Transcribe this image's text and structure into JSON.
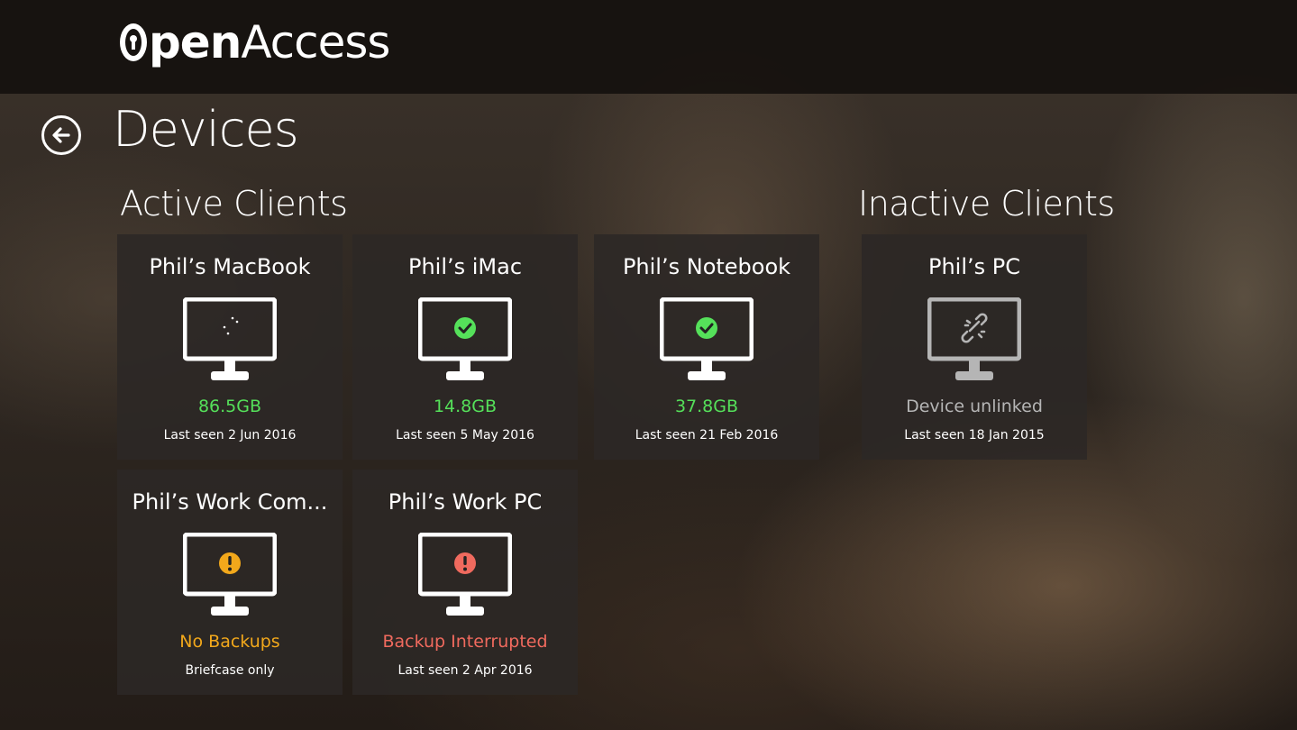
{
  "app": {
    "logo_open": "pen",
    "logo_access": "Access"
  },
  "page": {
    "title": "Devices"
  },
  "sections": {
    "active": "Active Clients",
    "inactive": "Inactive Clients"
  },
  "colors": {
    "green": "#55e05a",
    "orange": "#f2a81b",
    "red": "#f06a5e",
    "gray": "#b5b5b5",
    "white": "#ffffff"
  },
  "devices": [
    {
      "name": "Phil’s MacBook",
      "status": "86.5GB",
      "sub": "Last seen 2 Jun 2016",
      "state": "syncing",
      "status_color": "#55e05a"
    },
    {
      "name": "Phil’s iMac",
      "status": "14.8GB",
      "sub": "Last seen 5 May 2016",
      "state": "ok",
      "status_color": "#55e05a"
    },
    {
      "name": "Phil’s Notebook",
      "status": "37.8GB",
      "sub": "Last seen 21 Feb 2016",
      "state": "ok",
      "status_color": "#55e05a"
    },
    {
      "name": "Phil’s PC",
      "status": "Device unlinked",
      "sub": "Last seen 18 Jan 2015",
      "state": "unlinked",
      "status_color": "#b5b5b5"
    },
    {
      "name": "Phil’s Work Com...",
      "status": "No Backups",
      "sub": "Briefcase only",
      "state": "warning",
      "status_color": "#f2a81b"
    },
    {
      "name": "Phil’s Work PC",
      "status": "Backup Interrupted",
      "sub": "Last seen 2 Apr 2016",
      "state": "error",
      "status_color": "#f06a5e"
    }
  ],
  "icons": {
    "back": "back-arrow-icon",
    "monitor": "monitor-icon",
    "syncing": "spinner-icon",
    "ok": "check-circle-icon",
    "unlinked": "broken-link-icon",
    "warning": "warning-circle-icon",
    "error": "error-circle-icon"
  }
}
